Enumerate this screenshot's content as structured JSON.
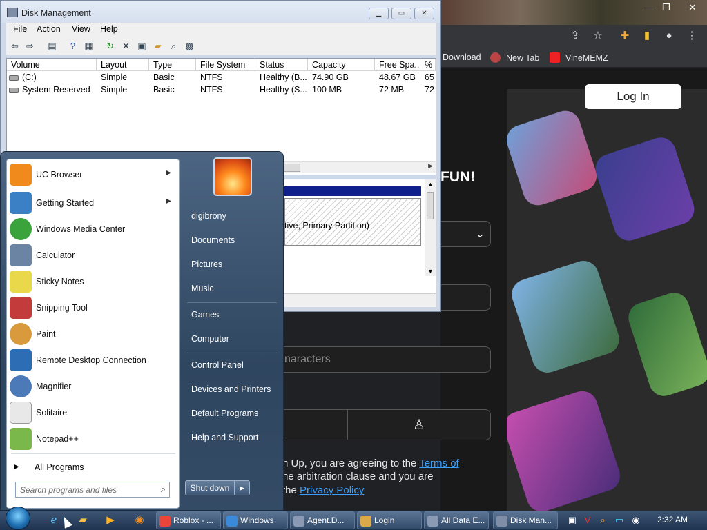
{
  "chrome": {
    "bookmarks": [
      "Download",
      "New Tab",
      "VineMEMZ"
    ],
    "login_label": "Log In",
    "fun_text": "FUN!",
    "chars_placeholder": "naracters",
    "legal_line1_a": "n Up, you are agreeing to the ",
    "legal_terms": "Terms of",
    "legal_line2": "he arbitration clause and you are",
    "legal_line3_a": "the ",
    "legal_privacy": "Privacy Policy"
  },
  "disk_mgmt": {
    "title": "Disk Management",
    "menu": [
      "File",
      "Action",
      "View",
      "Help"
    ],
    "columns": [
      "Volume",
      "Layout",
      "Type",
      "File System",
      "Status",
      "Capacity",
      "Free Spa...",
      "% F"
    ],
    "rows": [
      [
        "(C:)",
        "Simple",
        "Basic",
        "NTFS",
        "Healthy (B...",
        "74.90 GB",
        "48.67 GB",
        "65"
      ],
      [
        "System Reserved",
        "Simple",
        "Basic",
        "NTFS",
        "Healthy (S...",
        "100 MB",
        "72 MB",
        "72"
      ]
    ],
    "partition_text": "tive, Primary Partition)"
  },
  "start_menu": {
    "programs": [
      {
        "label": "UC Browser",
        "submenu": true,
        "color": "#f08a1c"
      },
      {
        "label": "Getting Started",
        "submenu": true,
        "color": "#3b7fc4"
      },
      {
        "label": "Windows Media Center",
        "submenu": false,
        "color": "#3aa33b"
      },
      {
        "label": "Calculator",
        "submenu": false,
        "color": "#6b84a3"
      },
      {
        "label": "Sticky Notes",
        "submenu": false,
        "color": "#e9d94a"
      },
      {
        "label": "Snipping Tool",
        "submenu": false,
        "color": "#c33b3b"
      },
      {
        "label": "Paint",
        "submenu": false,
        "color": "#d89a3c"
      },
      {
        "label": "Remote Desktop Connection",
        "submenu": false,
        "color": "#2d6db4"
      },
      {
        "label": "Magnifier",
        "submenu": false,
        "color": "#4c7ab8"
      },
      {
        "label": "Solitaire",
        "submenu": false,
        "color": "#e8e8e8"
      },
      {
        "label": "Notepad++",
        "submenu": false,
        "color": "#7bb84b"
      }
    ],
    "all_programs": "All Programs",
    "search_placeholder": "Search programs and files",
    "right_items": [
      "digibrony",
      "Documents",
      "Pictures",
      "Music",
      "Games",
      "Computer",
      "Control Panel",
      "Devices and Printers",
      "Default Programs",
      "Help and Support"
    ],
    "shutdown_label": "Shut down"
  },
  "taskbar": {
    "tasks": [
      "Roblox - ...",
      "Windows",
      "Agent.D...",
      "Login",
      "All Data E...",
      "Disk Man..."
    ],
    "clock": "2:32 AM"
  }
}
